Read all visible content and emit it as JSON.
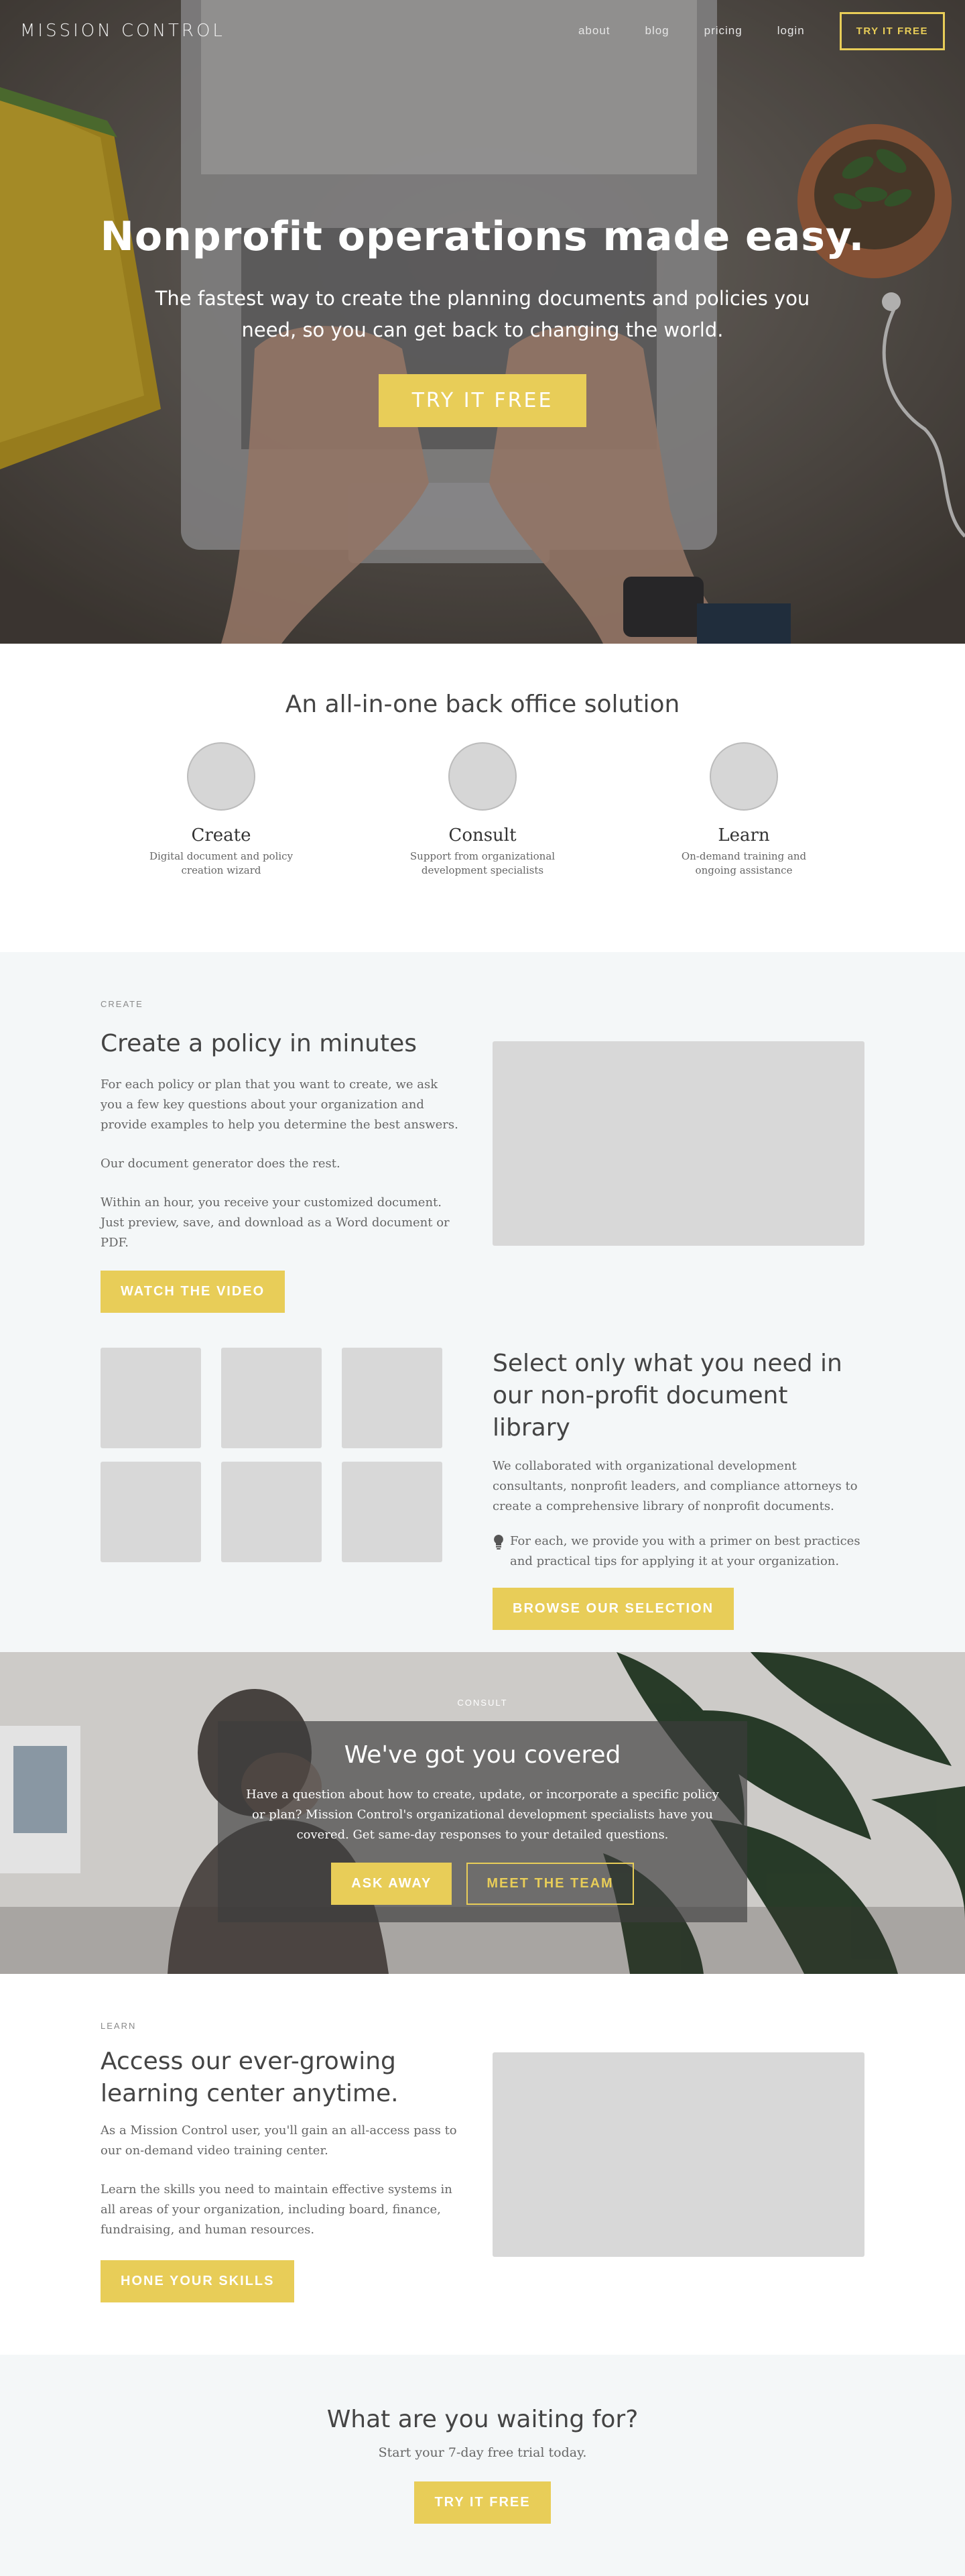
{
  "nav": {
    "brand": "MISSION CONTROL",
    "links": [
      "about",
      "blog",
      "pricing",
      "login"
    ],
    "cta": "TRY IT FREE"
  },
  "hero": {
    "title": "Nonprofit operations made easy.",
    "subtitle": "The fastest way to create the planning documents and policies you need, so you can get back to changing the world.",
    "cta": "TRY IT FREE"
  },
  "features": {
    "heading": "An all-in-one back office solution",
    "items": [
      {
        "title": "Create",
        "desc": "Digital document and policy creation wizard"
      },
      {
        "title": "Consult",
        "desc": "Support from organizational development specialists"
      },
      {
        "title": "Learn",
        "desc": "On-demand training and ongoing assistance"
      }
    ]
  },
  "create": {
    "eyebrow": "CREATE",
    "title": "Create a policy in minutes",
    "p1": "For each policy or plan that you want to create, we ask you a few key questions about your organization and provide examples to help you determine the best answers.",
    "p2": "Our document generator does the rest.",
    "p3": "Within an hour, you receive your customized document. Just preview, save, and download as a Word document or PDF.",
    "cta": "WATCH THE VIDEO",
    "library_title": "Select only what you need in our non-profit document library",
    "library_p": "We collaborated with organizational development consultants, nonprofit leaders, and compliance attorneys to create a comprehensive library of nonprofit documents.",
    "library_tip": "For each, we provide you with a primer on best practices and practical tips for applying it at your organization.",
    "library_cta": "BROWSE OUR SELECTION"
  },
  "consult": {
    "eyebrow": "CONSULT",
    "title": "We've got you covered",
    "text": "Have a question about how to create, update, or incorporate a specific policy or plan? Mission Control's organizational development specialists have you covered. Get same-day responses to your detailed questions.",
    "cta_primary": "ASK AWAY",
    "cta_secondary": "MEET THE TEAM"
  },
  "learn": {
    "eyebrow": "LEARN",
    "title": "Access our ever-growing learning center anytime.",
    "p1": "As a Mission Control user, you'll gain an all-access pass to our on-demand video training center.",
    "p2": "Learn the skills you need to maintain effective systems in all areas of your organization, including board, finance, fundraising, and human resources.",
    "cta": "HONE YOUR SKILLS"
  },
  "final": {
    "title": "What are you waiting for?",
    "subtitle": "Start your 7-day free trial today.",
    "cta": "TRY IT FREE"
  },
  "colors": {
    "accent": "#e8cd58",
    "light_bg": "#f4f7f8",
    "placeholder": "#d8d8d8"
  }
}
